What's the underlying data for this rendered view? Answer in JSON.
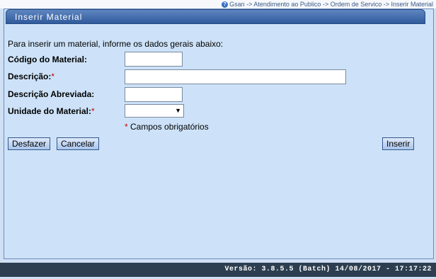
{
  "breadcrumb": "Gsan -> Atendimento ao Publico -> Ordem de Servico -> Inserir Material",
  "panel": {
    "title": "Inserir Material"
  },
  "form": {
    "intro": "Para inserir um material, informe os dados gerais abaixo:",
    "codigo_label": "Código do Material:",
    "codigo_value": "",
    "descricao_label": "Descrição:",
    "descricao_value": "",
    "descricao_abreviada_label": "Descrição Abreviada:",
    "descricao_abreviada_value": "",
    "unidade_label": "Unidade do Material:",
    "unidade_selected": "",
    "required_marker": "*",
    "required_note": "Campos obrigatórios"
  },
  "buttons": {
    "desfazer": "Desfazer",
    "cancelar": "Cancelar",
    "inserir": "Inserir"
  },
  "footer": {
    "version": "Versão: 3.8.5.5 (Batch) 14/08/2017 - 17:17:22"
  },
  "icons": {
    "breadcrumb": "help-icon",
    "select": "chevron-down-icon"
  }
}
